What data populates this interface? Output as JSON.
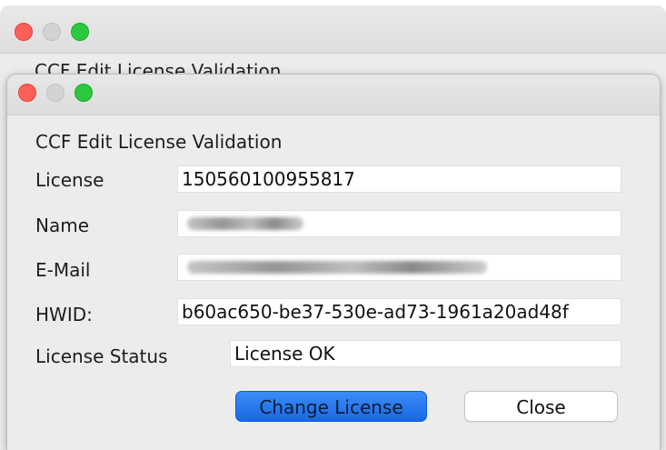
{
  "background_window": {
    "title_peek": "CCF Edit License Validation"
  },
  "dialog": {
    "title": "CCF Edit License Validation",
    "fields": {
      "license": {
        "label": "License",
        "value": "150560100955817"
      },
      "name": {
        "label": "Name",
        "value": ""
      },
      "email": {
        "label": "E-Mail",
        "value": ""
      },
      "hwid": {
        "label": "HWID:",
        "value": "b60ac650-be37-530e-ad73-1961a20ad48f"
      },
      "status": {
        "label": "License Status",
        "value": "License OK"
      }
    },
    "buttons": {
      "change_license": "Change License",
      "close": "Close"
    }
  },
  "colors": {
    "traffic_red": "#fe5f57",
    "traffic_gray": "#d3d3d3",
    "traffic_green": "#2bc840",
    "accent_blue": "#1868e6",
    "window_bg": "#ececec"
  },
  "icons": [
    "close-traffic-light-icon",
    "minimize-traffic-light-icon",
    "zoom-traffic-light-icon"
  ]
}
